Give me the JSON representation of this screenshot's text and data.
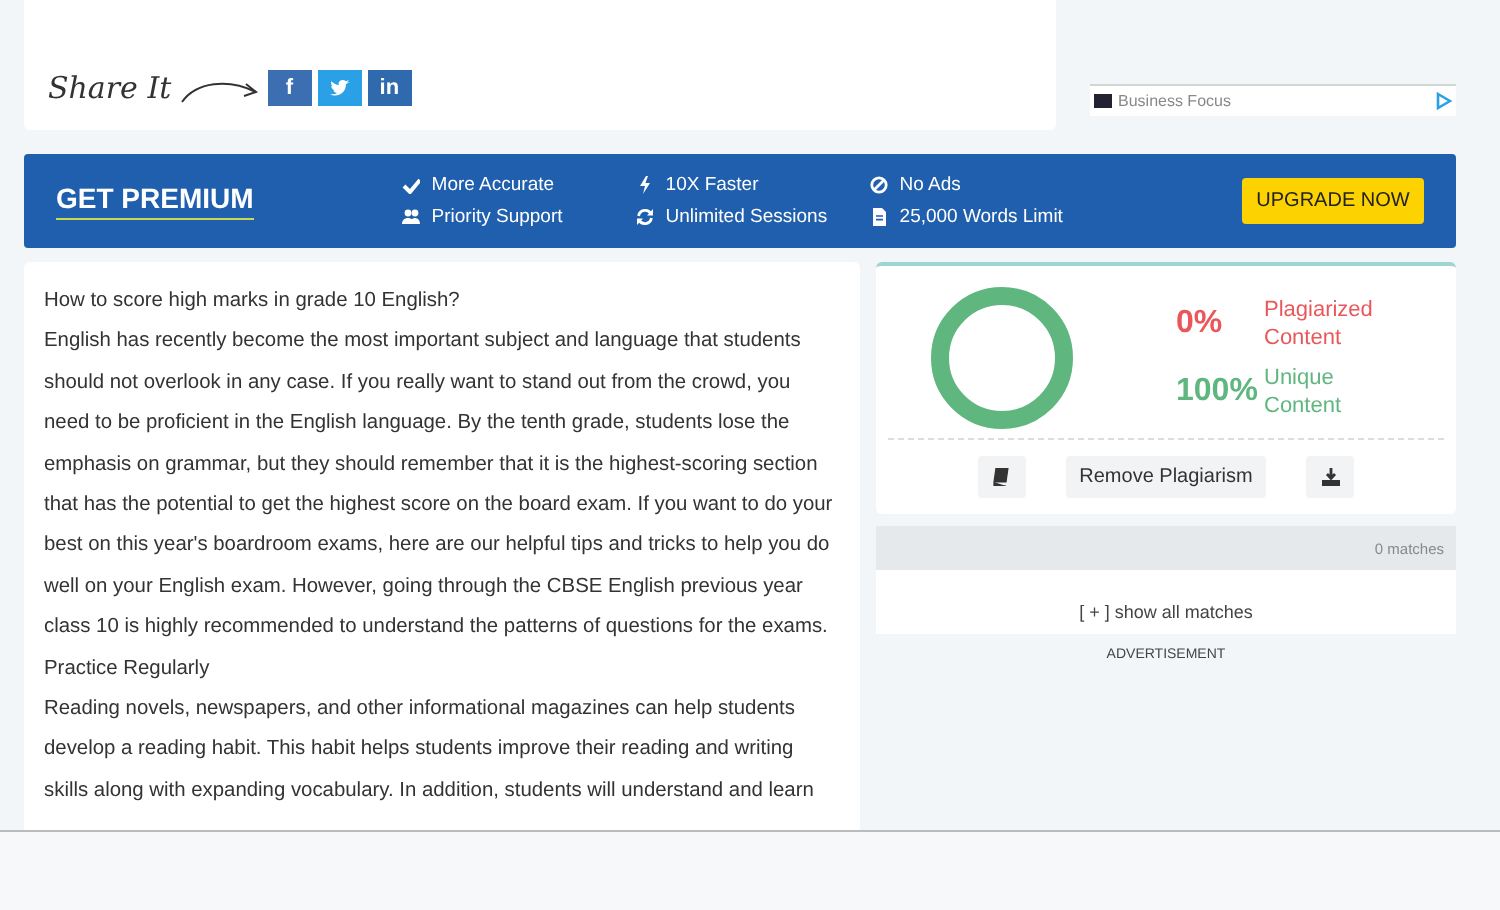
{
  "share": {
    "label": "Share It",
    "buttons": [
      {
        "kind": "facebook",
        "text": "f"
      },
      {
        "kind": "twitter"
      },
      {
        "kind": "linkedin",
        "text": "in"
      }
    ]
  },
  "ad": {
    "source": "Business Focus"
  },
  "premium": {
    "title": "GET PREMIUM",
    "features": [
      {
        "text": "More Accurate"
      },
      {
        "text": "10X Faster"
      },
      {
        "text": "No Ads"
      },
      {
        "text": "Priority Support"
      },
      {
        "text": "Unlimited Sessions"
      },
      {
        "text": "25,000 Words Limit"
      }
    ],
    "button": "UPGRADE NOW"
  },
  "article": {
    "paragraphs": [
      " How to score high marks in grade 10 English?",
      "English has recently become the most important subject and language that students should not overlook in any case. If you really want to stand out from the crowd, you need to be proficient in the English language. By the tenth grade, students lose the emphasis on grammar, but they should remember that it is the highest-scoring section that has the potential to get the highest score on the board exam.  If you want to do your best on this year's boardroom exams, here are our helpful tips and tricks to help you do well on your English exam. However, going through the CBSE English previous year class 10 is highly recommended to understand the patterns of questions for the exams.",
      "Practice Regularly",
      "Reading novels, newspapers, and other informational magazines can help students develop a reading habit. This habit helps students  improve their reading and writing skills along with expanding vocabulary. In addition, students will understand and learn"
    ]
  },
  "result": {
    "stats": [
      {
        "value": "0%",
        "label": "Plagiarized Content",
        "color": "#e9575b"
      },
      {
        "value": "100%",
        "label": "Unique Content",
        "color": "#5fb67f"
      }
    ],
    "actions": [
      {
        "kind": "book"
      },
      {
        "kind": "text",
        "text": "Remove Plagiarism"
      },
      {
        "kind": "download"
      }
    ]
  },
  "matches": {
    "count": "0 matches",
    "toggle": "[ + ] show all matches"
  },
  "advertisement": "ADVERTISEMENT"
}
